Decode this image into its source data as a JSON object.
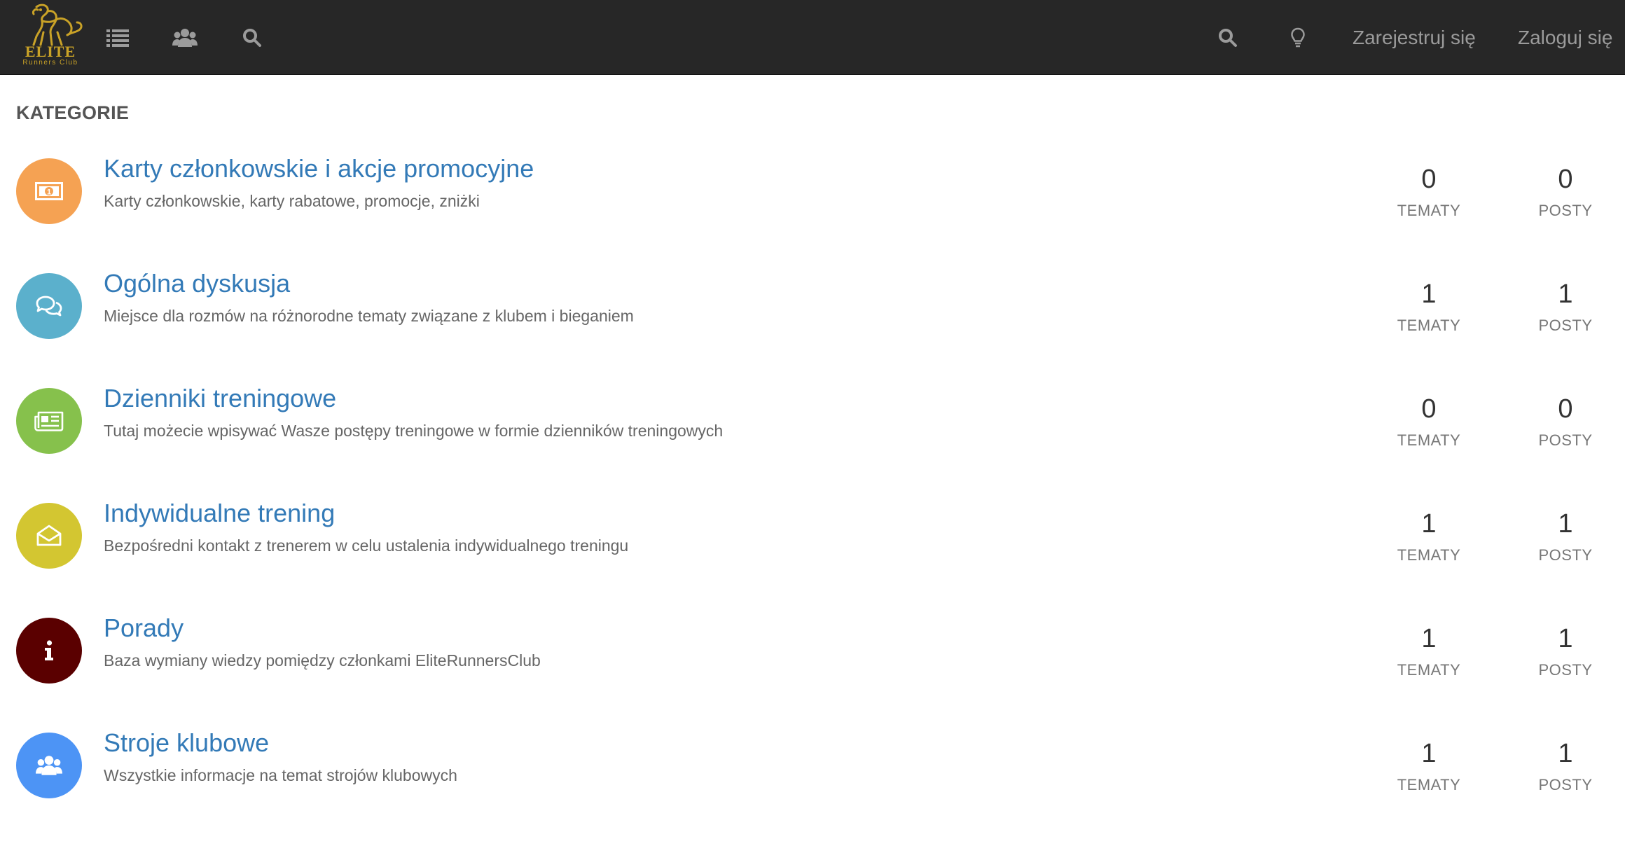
{
  "brand": {
    "name": "ELITE",
    "subtitle": "Runners Club",
    "color": "#c9a227"
  },
  "navbar": {
    "left_icons": [
      "list-icon",
      "users-icon",
      "search-icon"
    ],
    "right_icons": [
      "search-icon",
      "lightbulb-icon"
    ],
    "register_label": "Zarejestruj się",
    "login_label": "Zaloguj się"
  },
  "section_title": "KATEGORIE",
  "stat_labels": {
    "topics": "TEMATY",
    "posts": "POSTY"
  },
  "categories": [
    {
      "title": "Karty członkowskie i akcje promocyjne",
      "description": "Karty członkowskie, karty rabatowe, promocje, zniżki",
      "icon": "money-icon",
      "color": "#f5a253",
      "topics": "0",
      "posts": "0"
    },
    {
      "title": "Ogólna dyskusja",
      "description": "Miejsce dla rozmów na różnorodne tematy związane z klubem i bieganiem",
      "icon": "comments-icon",
      "color": "#5bb0cc",
      "topics": "1",
      "posts": "1"
    },
    {
      "title": "Dzienniki treningowe",
      "description": "Tutaj możecie wpisywać Wasze postępy treningowe w formie dzienników treningowych",
      "icon": "newspaper-icon",
      "color": "#86c14c",
      "topics": "0",
      "posts": "0"
    },
    {
      "title": "Indywidualne trening",
      "description": "Bezpośredni kontakt z trenerem w celu ustalenia indywidualnego treningu",
      "icon": "envelope-open-icon",
      "color": "#d3c631",
      "topics": "1",
      "posts": "1"
    },
    {
      "title": "Porady",
      "description": "Baza wymiany wiedzy pomiędzy członkami EliteRunnersClub",
      "icon": "info-icon",
      "color": "#5a0000",
      "topics": "1",
      "posts": "1"
    },
    {
      "title": "Stroje klubowe",
      "description": "Wszystkie informacje na temat strojów klubowych",
      "icon": "users-icon",
      "color": "#4d94f5",
      "topics": "1",
      "posts": "1"
    }
  ]
}
